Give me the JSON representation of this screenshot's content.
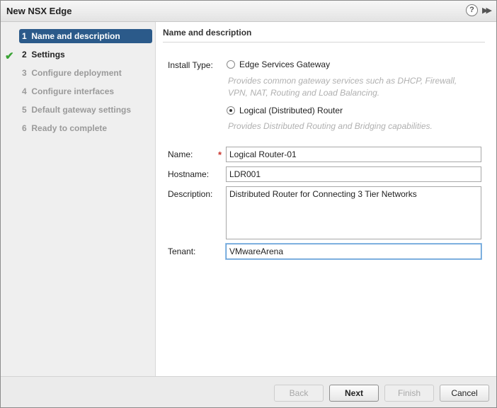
{
  "window": {
    "title": "New NSX Edge"
  },
  "icons": {
    "help": "?",
    "expand": "▶▶",
    "check": "✔"
  },
  "steps": [
    {
      "number": "1",
      "label": "Name and description",
      "state": "active"
    },
    {
      "number": "2",
      "label": "Settings",
      "state": "visited"
    },
    {
      "number": "3",
      "label": "Configure deployment",
      "state": "disabled"
    },
    {
      "number": "4",
      "label": "Configure interfaces",
      "state": "disabled"
    },
    {
      "number": "5",
      "label": "Default gateway settings",
      "state": "disabled"
    },
    {
      "number": "6",
      "label": "Ready to complete",
      "state": "disabled"
    }
  ],
  "section": {
    "title": "Name and description"
  },
  "install_type": {
    "label": "Install Type:",
    "options": [
      {
        "label": "Edge Services Gateway",
        "hint_line1": "Provides common gateway services such as DHCP, Firewall,",
        "hint_line2": "VPN, NAT, Routing and Load Balancing.",
        "selected": false
      },
      {
        "label": "Logical (Distributed) Router",
        "hint_line1": "Provides Distributed Routing and Bridging  capabilities.",
        "selected": true
      }
    ]
  },
  "form": {
    "name": {
      "label": "Name:",
      "value": "Logical Router-01",
      "required_mark": "*"
    },
    "hostname": {
      "label": "Hostname:",
      "value": "LDR001"
    },
    "description": {
      "label": "Description:",
      "value": "Distributed Router for Connecting 3 Tier Networks"
    },
    "tenant": {
      "label": "Tenant:",
      "value": "VMwareArena"
    }
  },
  "footer": {
    "back": "Back",
    "next": "Next",
    "finish": "Finish",
    "cancel": "Cancel"
  },
  "colors": {
    "active_step": "#2b5a8a",
    "check": "#3aa335",
    "required": "#c9342c",
    "focus_ring": "#5b98d1"
  }
}
